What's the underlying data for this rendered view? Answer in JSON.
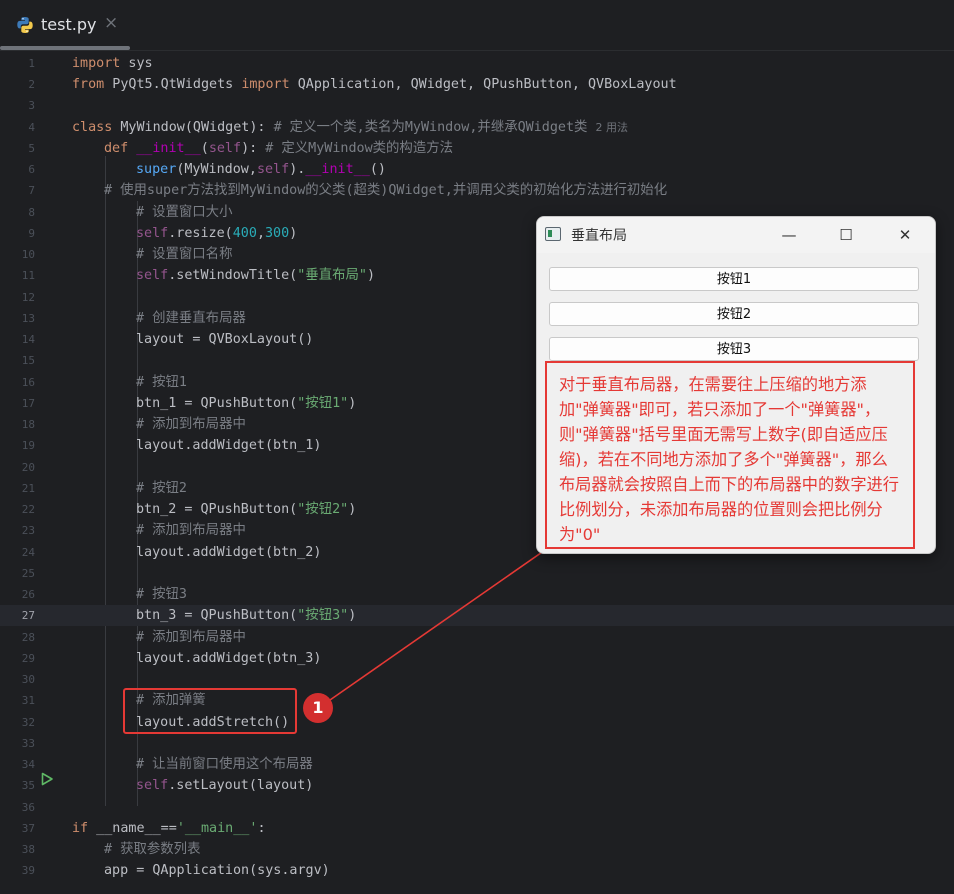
{
  "tab": {
    "filename": "test.py",
    "close": "×"
  },
  "gutter": {
    "line_numbers": [
      "1",
      "2",
      "3",
      "4",
      "5",
      "6",
      "7",
      "8",
      "9",
      "10",
      "11",
      "12",
      "13",
      "14",
      "15",
      "16",
      "17",
      "18",
      "19",
      "20",
      "21",
      "22",
      "23",
      "24",
      "25",
      "26",
      "27",
      "28",
      "29",
      "30",
      "31",
      "32",
      "33",
      "34",
      "35",
      "36",
      "37",
      "38",
      "39"
    ],
    "current_line": "27"
  },
  "code": {
    "l1": {
      "kw": "import",
      "rest": " sys"
    },
    "l2": {
      "kw1": "from",
      "mod": " PyQt5.QtWidgets ",
      "kw2": "import",
      "rest": " QApplication, QWidget, QPushButton, QVBoxLayout"
    },
    "l4": {
      "kw": "class",
      "cls": " MyWindow",
      "rest": "(QWidget): ",
      "comment": "# 定义一个类,类名为MyWindow,并继承QWidget类",
      "hint": "2 用法"
    },
    "l5": {
      "kw": "def",
      "fn": " __init__",
      "p1": "(",
      "self": "self",
      "p2": "): ",
      "comment": "# 定义MyWindow类的构造方法"
    },
    "l6": {
      "a": "super",
      "b": "(MyWindow,",
      "self": "self",
      "c": ").",
      "d": "__init__",
      "e": "()"
    },
    "l7": {
      "comment": "# 使用super方法找到MyWindow的父类(超类)QWidget,并调用父类的初始化方法进行初始化"
    },
    "l8": {
      "comment": "# 设置窗口大小"
    },
    "l9": {
      "self": "self",
      "a": ".resize(",
      "n1": "400",
      "b": ",",
      "n2": "300",
      "c": ")"
    },
    "l10": {
      "comment": "# 设置窗口名称"
    },
    "l11": {
      "self": "self",
      "a": ".setWindowTitle(",
      "s": "\"垂直布局\"",
      "b": ")"
    },
    "l13": {
      "comment": "# 创建垂直布局器"
    },
    "l14": {
      "text": "layout = QVBoxLayout()"
    },
    "l16": {
      "comment": "# 按钮1"
    },
    "l17": {
      "a": "btn_1 = QPushButton(",
      "s": "\"按钮1\"",
      "b": ")"
    },
    "l18": {
      "comment": "# 添加到布局器中"
    },
    "l19": {
      "text": "layout.addWidget(btn_1)"
    },
    "l21": {
      "comment": "# 按钮2"
    },
    "l22": {
      "a": "btn_2 = QPushButton(",
      "s": "\"按钮2\"",
      "b": ")"
    },
    "l23": {
      "comment": "# 添加到布局器中"
    },
    "l24": {
      "text": "layout.addWidget(btn_2)"
    },
    "l26": {
      "comment": "# 按钮3"
    },
    "l27": {
      "a": "btn_3 = QPushButton(",
      "s": "\"按钮3\"",
      "b": ")"
    },
    "l28": {
      "comment": "# 添加到布局器中"
    },
    "l29": {
      "text": "layout.addWidget(btn_3)"
    },
    "l31": {
      "comment": "# 添加弹簧"
    },
    "l32": {
      "text": "layout.addStretch()"
    },
    "l34": {
      "comment": "# 让当前窗口使用这个布局器"
    },
    "l35": {
      "self": "self",
      "a": ".setLayout(layout)"
    },
    "l37": {
      "kw": "if",
      "a": " __name__==",
      "s": "'__main__'",
      "b": ":"
    },
    "l38": {
      "comment": "# 获取参数列表"
    },
    "l39": {
      "text": "app = QApplication(sys.argv)"
    }
  },
  "annotation": {
    "badge": "1",
    "color": "#e53935",
    "callout_text": "对于垂直布局器，在需要往上压缩的地方添加\"弹簧器\"即可，若只添加了一个\"弹簧器\"，则\"弹簧器\"括号里面无需写上数字(即自适应压缩)，若在不同地方添加了多个\"弹簧器\"，那么布局器就会按照自上而下的布局器中的数字进行比例划分，未添加布局器的位置则会把比例分为\"0\""
  },
  "qt_window": {
    "title": "垂直布局",
    "minimize": "—",
    "maximize": "☐",
    "close": "✕",
    "buttons": [
      "按钮1",
      "按钮2",
      "按钮3"
    ]
  },
  "icons": [
    "python-file-icon",
    "close-icon",
    "run-icon",
    "window-icon",
    "minimize-icon",
    "maximize-icon",
    "close-window-icon"
  ]
}
